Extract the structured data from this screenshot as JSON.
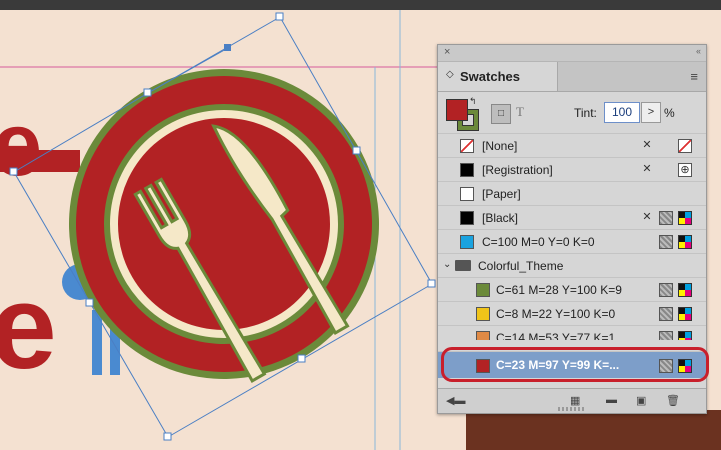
{
  "panel": {
    "close_glyph": "×",
    "collapse_glyph": "‹‹",
    "tab_icon": "◇",
    "tab_title": "Swatches",
    "menu_glyph": "≡"
  },
  "controls": {
    "swap_glyph": "↰",
    "frame_glyph": "□",
    "text_glyph": "T",
    "tint_label": "Tint:",
    "tint_value": "100",
    "tint_arrow": ">",
    "tint_percent": "%"
  },
  "swatches": [
    {
      "label": "[None]",
      "chip": "#ffffff"
    },
    {
      "label": "[Registration]",
      "chip": "#000000"
    },
    {
      "label": "[Paper]",
      "chip": "#ffffff"
    },
    {
      "label": "[Black]",
      "chip": "#000000"
    },
    {
      "label": "C=100 M=0 Y=0 K=0",
      "chip": "#1aa3e0"
    },
    {
      "label": "Colorful_Theme"
    },
    {
      "label": "C=61 M=28 Y=100 K=9",
      "chip": "#6b8a3a"
    },
    {
      "label": "C=8 M=22 Y=100 K=0",
      "chip": "#f0c419"
    },
    {
      "label": "C=14 M=53 Y=77 K=1",
      "chip": "#e08a45"
    },
    {
      "label": "C=23 M=97 Y=99 K=...",
      "chip": "#b22224"
    }
  ],
  "colors": {
    "accent_red": "#b22224",
    "olive": "#6b8a3a",
    "cream": "#f5e8c8",
    "canvas": "#f4e1d1",
    "selection_blue": "#7d9ec9",
    "highlight_ring": "#c81f2b"
  },
  "icons": {
    "close": "close-icon",
    "collapse": "collapse-icon",
    "menu": "panel-menu-icon",
    "folder": "folder-icon",
    "new_swatch": "new-swatch-icon",
    "delete": "trash-icon"
  }
}
